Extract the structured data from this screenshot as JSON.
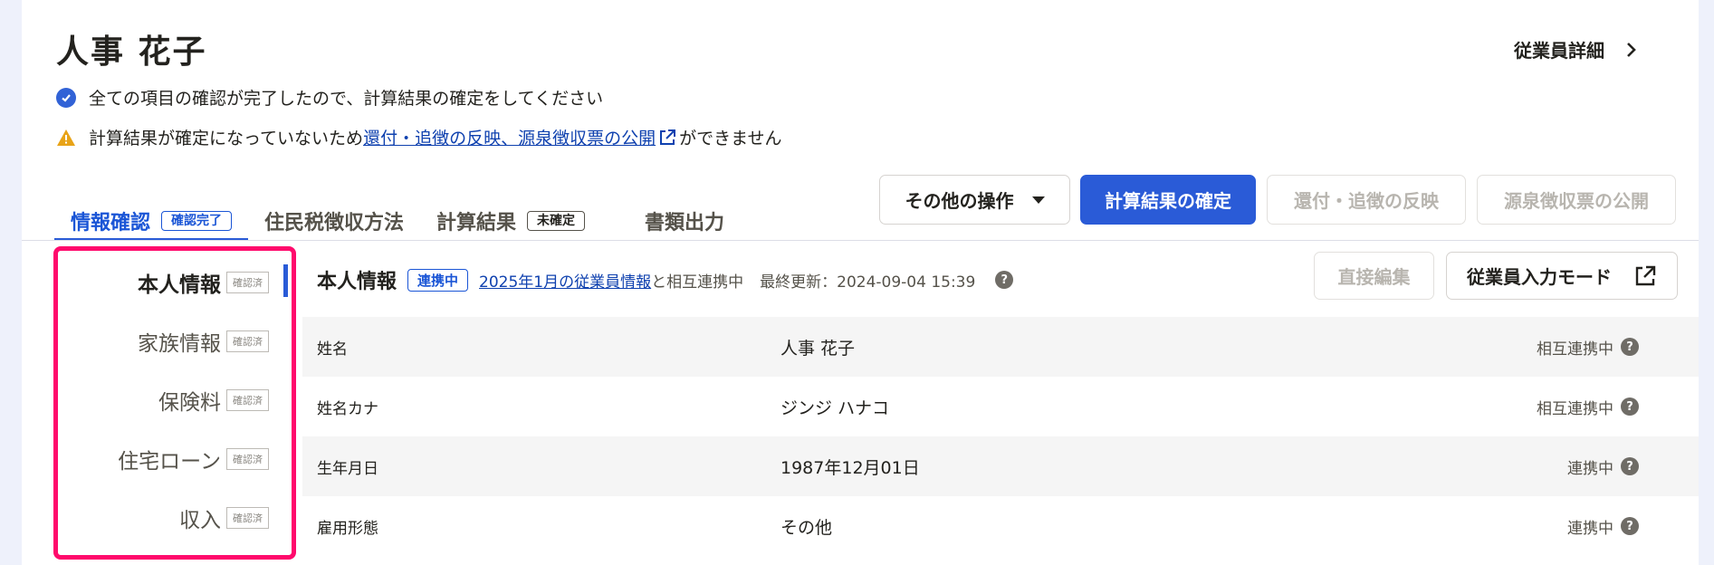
{
  "employee": {
    "name": "人事 花子"
  },
  "header": {
    "detail_link": "従業員詳細"
  },
  "messages": {
    "info": "全ての項目の確認が完了したので、計算結果の確定をしてください",
    "warning_prefix": "計算結果が確定になっていないため",
    "warning_link": "還付・追徴の反映、源泉徴収票の公開",
    "warning_suffix": "ができません"
  },
  "tabs": [
    {
      "label": "情報確認",
      "badge": "確認完了",
      "active": true
    },
    {
      "label": "住民税徴収方法",
      "badge": ""
    },
    {
      "label": "計算結果",
      "badge": "未確定"
    },
    {
      "label": "書類出力",
      "badge": ""
    }
  ],
  "actions": {
    "other": "その他の操作",
    "confirm": "計算結果の確定",
    "refund": "還付・追徴の反映",
    "publish": "源泉徴収票の公開"
  },
  "side_nav": {
    "items": [
      {
        "label": "本人情報",
        "badge": "確認済",
        "active": true
      },
      {
        "label": "家族情報",
        "badge": "確認済"
      },
      {
        "label": "保険料",
        "badge": "確認済"
      },
      {
        "label": "住宅ローン",
        "badge": "確認済"
      },
      {
        "label": "収入",
        "badge": "確認済"
      }
    ]
  },
  "section": {
    "title": "本人情報",
    "badge": "連携中",
    "link_text": "2025年1月の従業員情報",
    "link_suffix": "と相互連携中",
    "last_updated": "最終更新：2024-09-04 15:39",
    "direct_edit": "直接編集",
    "employee_mode": "従業員入力モード"
  },
  "rows": [
    {
      "label": "姓名",
      "value": "人事 花子",
      "status": "相互連携中"
    },
    {
      "label": "姓名カナ",
      "value": "ジンジ ハナコ",
      "status": "相互連携中"
    },
    {
      "label": "生年月日",
      "value": "1987年12月01日",
      "status": "連携中"
    },
    {
      "label": "雇用形態",
      "value": "その他",
      "status": "連携中"
    }
  ],
  "colors": {
    "accent": "#2a5bd7",
    "highlight_border": "#ff0a6c",
    "warning": "#e8a317"
  }
}
